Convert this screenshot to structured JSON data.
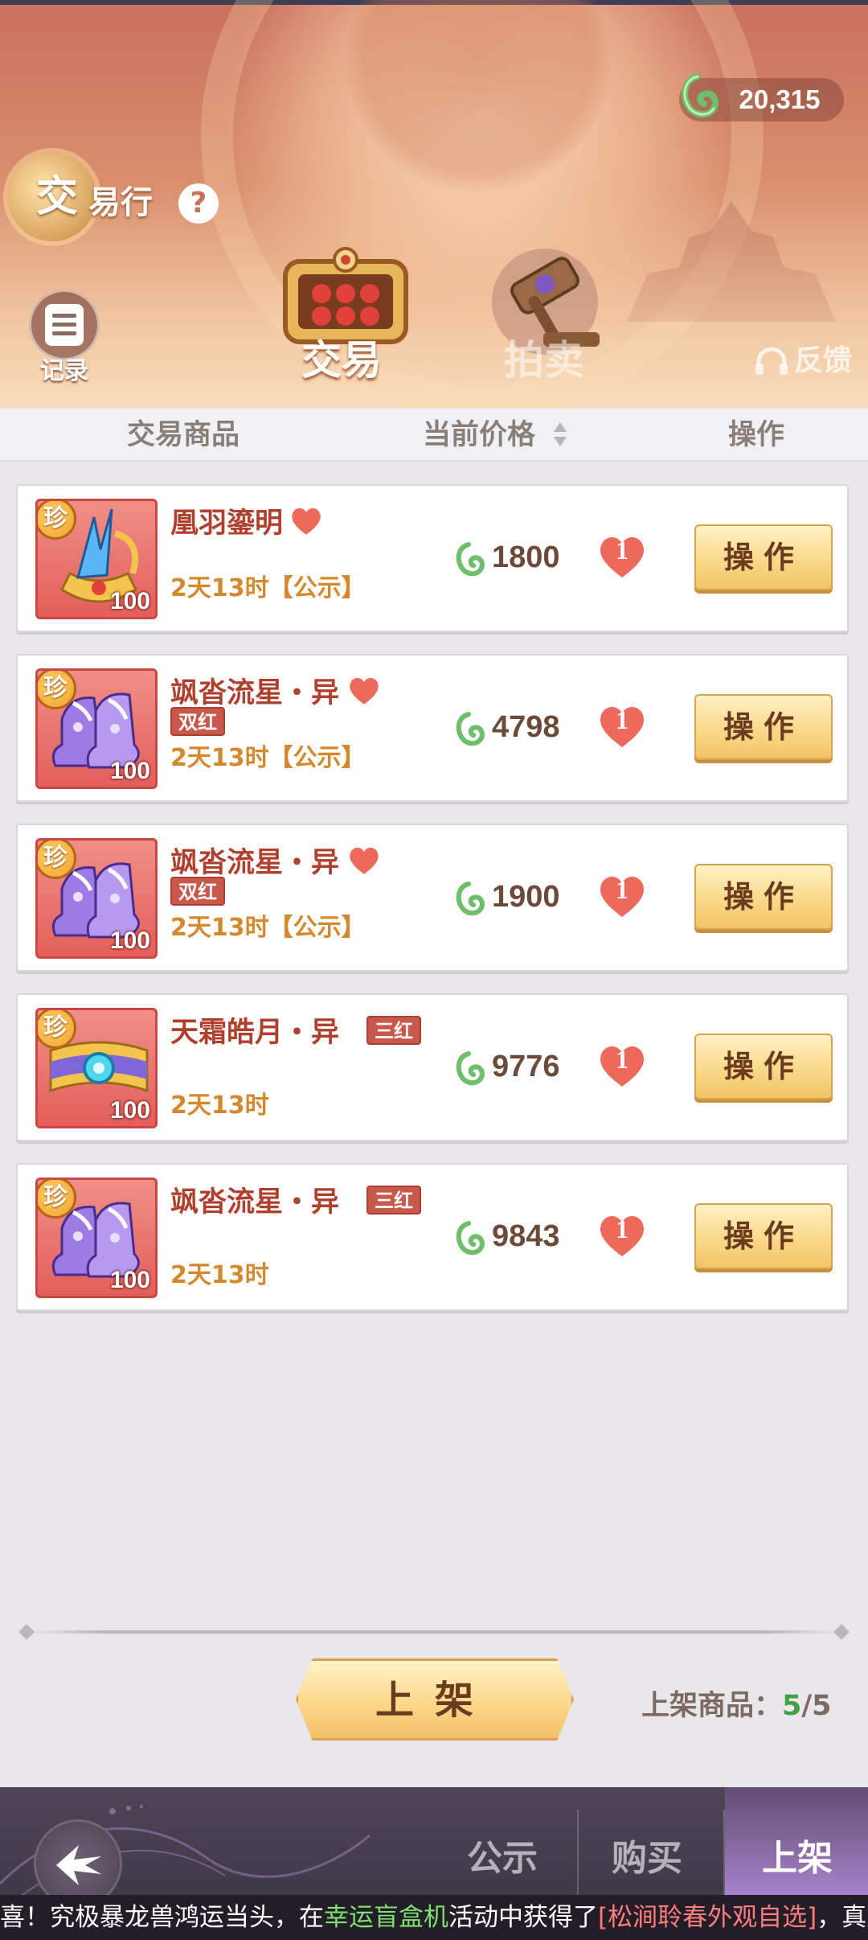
{
  "header": {
    "currency_value": "20,315",
    "title_first_char": "交",
    "title_rest": "易行",
    "help_symbol": "?",
    "record_label": "记录",
    "modes": [
      {
        "label": "交易",
        "active": true
      },
      {
        "label": "拍卖",
        "active": false
      }
    ],
    "feedback_label": "反馈"
  },
  "columns": {
    "item": "交易商品",
    "price": "当前价格",
    "action": "操作"
  },
  "items": [
    {
      "name": "凰羽鎏明",
      "rare_badge": "珍",
      "level": "100",
      "tag": "",
      "time": "2天13时【公示】",
      "price": "1800",
      "likes": "1",
      "action_label": "操作",
      "art": "crown"
    },
    {
      "name": "飒沓流星・异",
      "rare_badge": "珍",
      "level": "100",
      "tag": "双红",
      "time": "2天13时【公示】",
      "price": "4798",
      "likes": "1",
      "action_label": "操作",
      "art": "boots"
    },
    {
      "name": "飒沓流星・异",
      "rare_badge": "珍",
      "level": "100",
      "tag": "双红",
      "time": "2天13时【公示】",
      "price": "1900",
      "likes": "1",
      "action_label": "操作",
      "art": "boots"
    },
    {
      "name": "天霜皓月・异",
      "rare_badge": "珍",
      "level": "100",
      "tag": "三红",
      "time": "2天13时",
      "price": "9776",
      "likes": "1",
      "action_label": "操作",
      "art": "belt"
    },
    {
      "name": "飒沓流星・异",
      "rare_badge": "珍",
      "level": "100",
      "tag": "三红",
      "time": "2天13时",
      "price": "9843",
      "likes": "1",
      "action_label": "操作",
      "art": "boots"
    }
  ],
  "footer": {
    "list_button": "上架",
    "listing_label": "上架商品：",
    "listing_count": "5",
    "listing_total": "/5"
  },
  "bottom_nav": {
    "tabs": [
      {
        "label": "公示",
        "active": false
      },
      {
        "label": "购买",
        "active": false
      },
      {
        "label": "上架",
        "active": true
      }
    ]
  },
  "ticker": {
    "part1": "喜！究极暴龙兽鸿运当头，在",
    "event": "幸运盲盒机",
    "part2": "活动中获得了",
    "prize": "[松涧聆春外观自选]",
    "part3": "，真是福星"
  },
  "colors": {
    "accent_gold": "#f9d98a",
    "name_red": "#b0402e",
    "time_orange": "#d4892e",
    "count_green": "#45a045"
  },
  "icons": [
    "jade-currency-icon",
    "help-icon",
    "record-icon",
    "abacus-icon",
    "gavel-icon",
    "headset-icon",
    "sort-icon",
    "heart-icon",
    "like-icon",
    "back-arrow-icon"
  ]
}
